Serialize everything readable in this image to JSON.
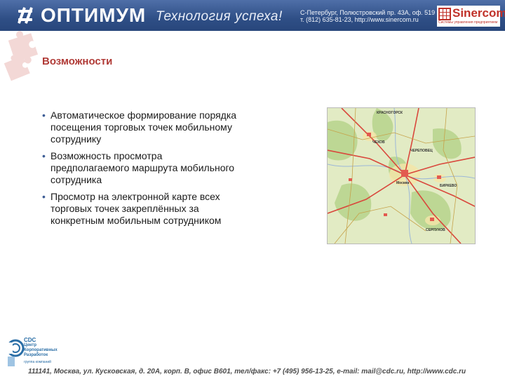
{
  "header": {
    "logo_text": "ОПТИМУМ",
    "slogan": "Технология успеха!",
    "contact_line1": "С-Петербург, Полюстровский пр. 43А, оф. 519",
    "contact_line2": "т. (812) 635-81-23, http://www.sinercom.ru",
    "partner_name": "Sinercom",
    "partner_tagline": "Системы управления предприятием"
  },
  "slide": {
    "title": "Возможности",
    "bullets": [
      "Автоматическое формирование порядка посещения торговых точек мобильному сотруднику",
      "Возможность просмотра предполагаемого маршрута мобильного сотрудника",
      "Просмотр на электронной карте всех торговых точек закреплённых за конкретным мобильным сотрудником"
    ],
    "map_labels": [
      "КРАСНОГОРСК",
      "ЧЕХОВ",
      "ЧЕРЕПОВЕЦ",
      "БИРКЕВО",
      "Москва",
      "СЕРПУХОВ"
    ]
  },
  "footer": {
    "cdc_logo_text": "CDC",
    "cdc_line1": "Центр",
    "cdc_line2": "Корпоративных",
    "cdc_line3": "Разработок",
    "cdc_tagline": "группа компаний",
    "address": "111141, Москва, ул. Кусковская, д. 20А, корп. В, офис В601, тел/факс: +7 (495) 956-13-25, e-mail: mail@cdc.ru, http://www.cdc.ru"
  },
  "colors": {
    "header_blue": "#2f4f86",
    "title_red": "#b03a36",
    "accent_blue": "#3d5d95",
    "partner_red": "#c0322a"
  }
}
